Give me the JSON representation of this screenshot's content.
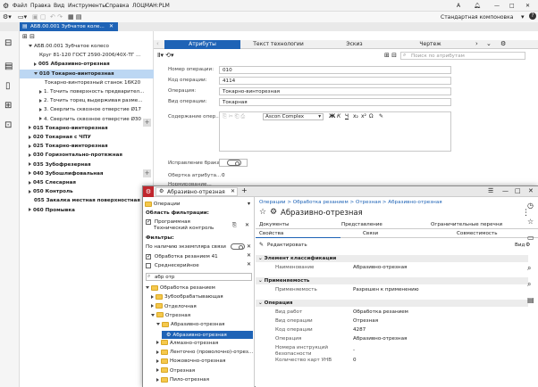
{
  "back": {
    "app_menu": [
      "Файл",
      "Правка",
      "Вид",
      "Инструменты",
      "Справка",
      "ЛОЦМАН:PLM"
    ],
    "window_user_initial": "A",
    "window_controls": [
      "—",
      "□",
      "✕"
    ],
    "layout_label": "Стандартная компоновка",
    "doc_tab": "АБВ.00.001 Зубчатое коле...",
    "tree": [
      {
        "label": "АБВ.00.001 Зубчатое колесо",
        "indent": 1,
        "caret": "down",
        "bold": false
      },
      {
        "label": "Круг 81-120 ГОСТ 2590-2006/40Х-ТГ ...",
        "indent": 2,
        "caret": "",
        "bold": false
      },
      {
        "label": "005 Абразивно-отрезная",
        "indent": 2,
        "caret": "right",
        "bold": true
      },
      {
        "label": "010 Токарно-винторезная",
        "indent": 2,
        "caret": "down",
        "bold": true,
        "selected": true
      },
      {
        "label": "Токарно-винторезный станок 16К20",
        "indent": 3,
        "caret": "",
        "bold": false
      },
      {
        "label": "1. Точить поверхность предварител...",
        "indent": 3,
        "caret": "right",
        "bold": false
      },
      {
        "label": "2. Точить торец выдерживая разме...",
        "indent": 3,
        "caret": "right",
        "bold": false
      },
      {
        "label": "3. Сверлить сквозное отверстие Ø17",
        "indent": 3,
        "caret": "right",
        "bold": false
      },
      {
        "label": "4. Сверлить сквозное отверстие Ø30",
        "indent": 3,
        "caret": "right",
        "bold": false
      },
      {
        "label": "015 Токарно-винторезная",
        "indent": 1,
        "caret": "right",
        "bold": true
      },
      {
        "label": "020 Токарная с ЧПУ",
        "indent": 1,
        "caret": "right",
        "bold": true
      },
      {
        "label": "025 Токарно-винторезная",
        "indent": 1,
        "caret": "right",
        "bold": true
      },
      {
        "label": "030 Горизонтально-протяжная",
        "indent": 1,
        "caret": "right",
        "bold": true
      },
      {
        "label": "035 Зубофрезерная",
        "indent": 1,
        "caret": "right",
        "bold": true
      },
      {
        "label": "040 Зубошлифовальная",
        "indent": 1,
        "caret": "right",
        "bold": true
      },
      {
        "label": "045 Слесарная",
        "indent": 1,
        "caret": "right",
        "bold": true
      },
      {
        "label": "050 Контроль",
        "indent": 1,
        "caret": "right",
        "bold": true
      },
      {
        "label": "055 Закалка местная поверхностная",
        "indent": 1,
        "caret": "",
        "bold": true
      },
      {
        "label": "060 Промывка",
        "indent": 1,
        "caret": "right",
        "bold": true
      }
    ],
    "right_tabs": [
      "Атрибуты",
      "Текст технологии",
      "Эскиз",
      "Чертеж"
    ],
    "search_placeholder": "Поиск по атрибутам",
    "fields": [
      {
        "label": "Номер операции:",
        "value": "010"
      },
      {
        "label": "Код операции:",
        "value": "4114"
      },
      {
        "label": "Операция:",
        "value": "Токарно-винторезная"
      },
      {
        "label": "Вид операции:",
        "value": "Токарная"
      }
    ],
    "content_label": "Содержание опер...",
    "font_name": "Ascon Complex",
    "format_buttons": [
      "Ж",
      "К",
      "Ч",
      "x₂",
      "x²",
      "Ω"
    ],
    "defect_label": "Исправление брака:",
    "wrap_label": "Обертка атрибута...",
    "wrap_value": "0",
    "next_label": "Нормирование..."
  },
  "front": {
    "tab_title": "Абразивно-отрезная",
    "window_controls": [
      "☰",
      "—",
      "□",
      "✕"
    ],
    "operations_label": "Операции",
    "filter_area_label": "Область фильтрации:",
    "filter_program": "Программная",
    "filter_program_sub": "Технический контроль",
    "filters_label": "Фильтры:",
    "filter_items": [
      {
        "label": "По наличию экземпляра связи",
        "kind": "toggle"
      },
      {
        "label": "Обработка резанием 41",
        "kind": "check-on"
      },
      {
        "label": "Среднесерийное",
        "kind": "check-off"
      }
    ],
    "search_value": "абр отр",
    "tree": [
      {
        "label": "Обработка резанием",
        "indent": 0,
        "caret": "down",
        "icon": "folder"
      },
      {
        "label": "Зубообрабатывающая",
        "indent": 1,
        "caret": "right",
        "icon": "folder"
      },
      {
        "label": "Отделочная",
        "indent": 1,
        "caret": "right",
        "icon": "folder"
      },
      {
        "label": "Отрезная",
        "indent": 1,
        "caret": "down",
        "icon": "folder"
      },
      {
        "label": "Абразивно-отрезная",
        "indent": 2,
        "caret": "down",
        "icon": "folder"
      },
      {
        "label": "Абразивно-отрезная",
        "indent": 3,
        "caret": "",
        "icon": "gear",
        "selected": true
      },
      {
        "label": "Алмазно-отрезная",
        "indent": 2,
        "caret": "right",
        "icon": "folder"
      },
      {
        "label": "Ленточно (проволочно)-отрез...",
        "indent": 2,
        "caret": "right",
        "icon": "folder"
      },
      {
        "label": "Ножовочно-отрезная",
        "indent": 2,
        "caret": "right",
        "icon": "folder"
      },
      {
        "label": "Отрезная",
        "indent": 2,
        "caret": "right",
        "icon": "folder"
      },
      {
        "label": "Пило-отрезная",
        "indent": 2,
        "caret": "right",
        "icon": "folder"
      }
    ],
    "breadcrumb": "Операции > Обработка резанием > Отрезная > Абразивно-отрезная",
    "title": "Абразивно-отрезная",
    "tabs_row1": [
      "Документы",
      "Представление",
      "Ограничительные перечни"
    ],
    "tabs_row2": [
      "Свойства",
      "Связи",
      "Совместимость"
    ],
    "edit_label": "Редактировать",
    "view_label": "Вид",
    "sections": [
      {
        "title": "Элемент классификации",
        "rows": [
          {
            "label": "Наименование",
            "value": "Абразивно-отрезная"
          }
        ]
      },
      {
        "title": "Применяемость",
        "rows": [
          {
            "label": "Применяемость",
            "value": "Разрешен к применению"
          }
        ]
      },
      {
        "title": "Операция",
        "rows": [
          {
            "label": "Вид работ",
            "value": "Обработка резанием"
          },
          {
            "label": "Вид операции",
            "value": "Отрезная"
          },
          {
            "label": "Код операции",
            "value": "4287"
          },
          {
            "label": "Операция",
            "value": "Абразивно-отрезная"
          },
          {
            "label": "Номера инструкций безопасности",
            "value": "-"
          },
          {
            "label": "Количество карт УНВ",
            "value": "0"
          }
        ]
      }
    ]
  },
  "colors": {
    "accent": "#1e63b6",
    "selection": "#bcd7f3",
    "folder": "#f5c84c",
    "logo": "#c0262d"
  }
}
